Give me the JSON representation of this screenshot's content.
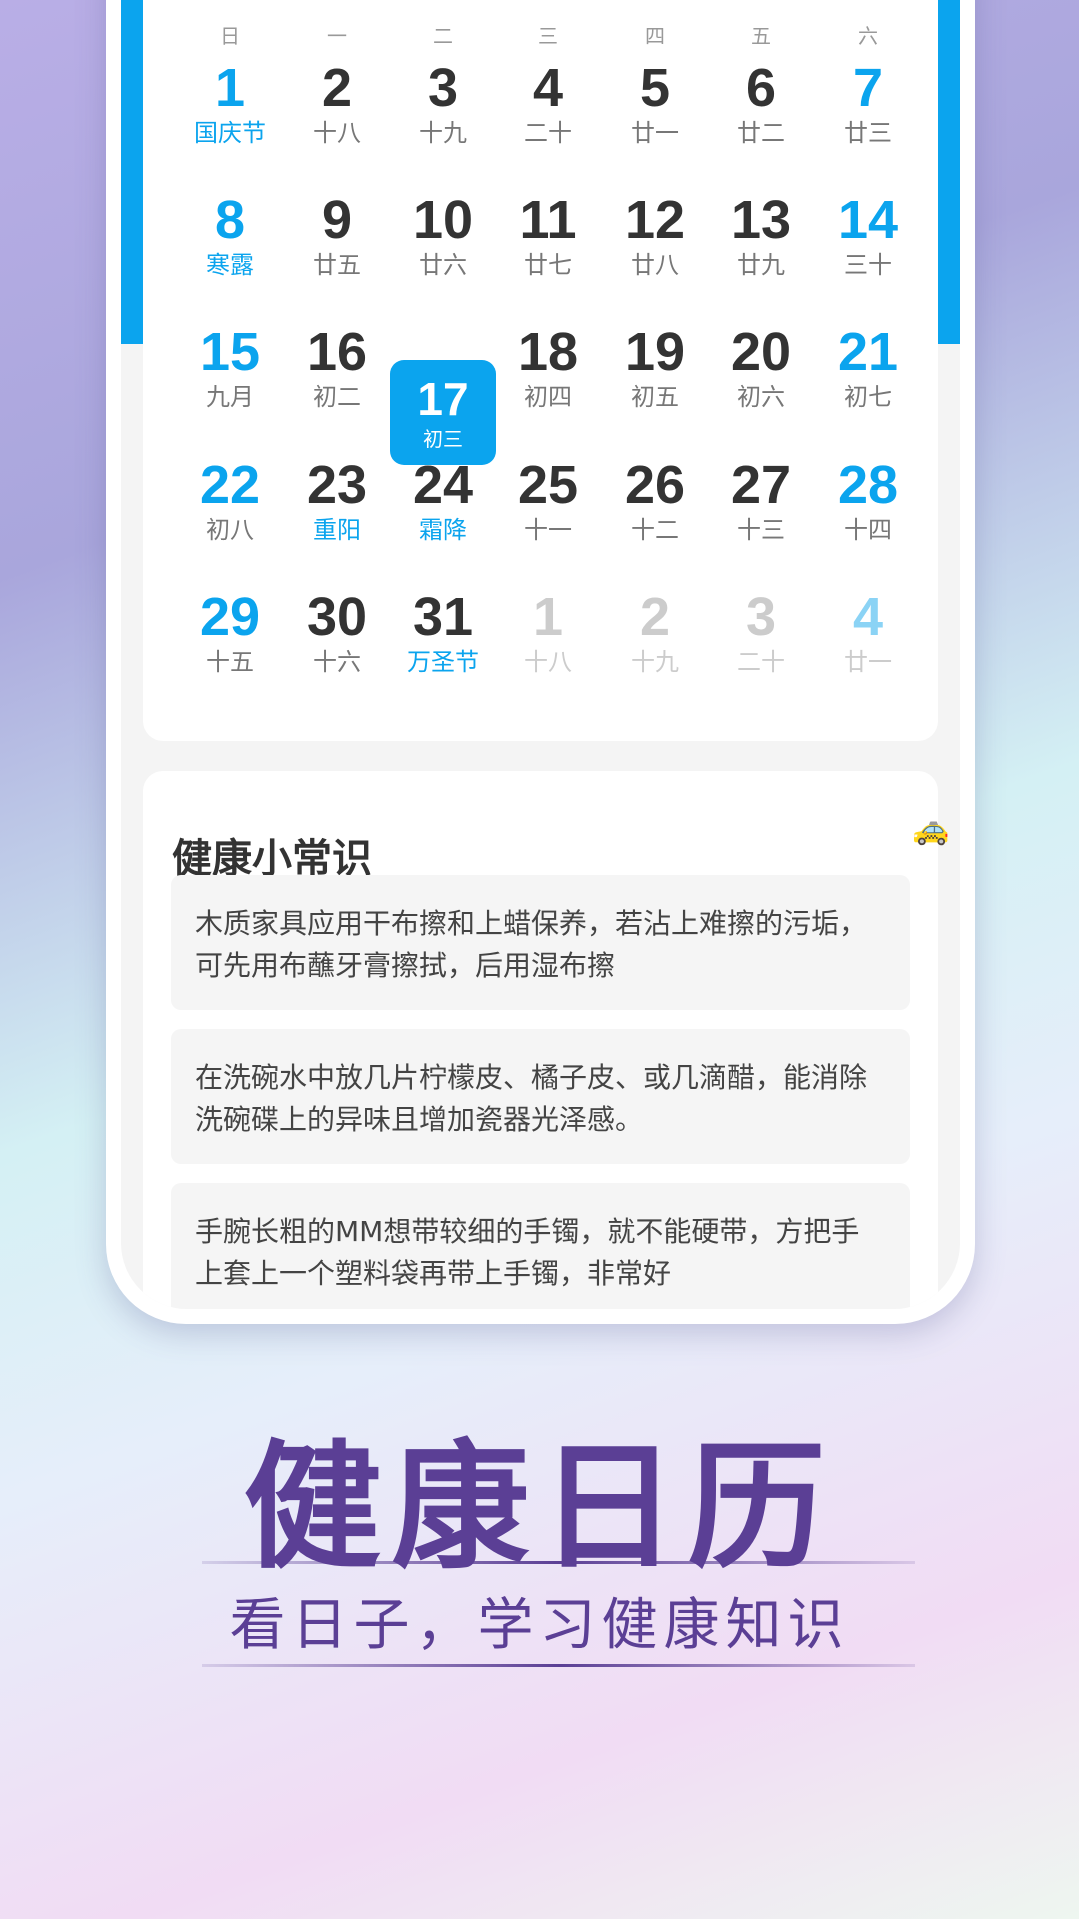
{
  "calendar": {
    "weekdays": [
      "日",
      "一",
      "二",
      "三",
      "四",
      "五",
      "六"
    ],
    "selected_day": 17,
    "accent_color": "#0ba4ee",
    "weeks": [
      [
        {
          "d": "1",
          "l": "国庆节",
          "f": 1
        },
        {
          "d": "2",
          "l": "十八"
        },
        {
          "d": "3",
          "l": "十九"
        },
        {
          "d": "4",
          "l": "二十"
        },
        {
          "d": "5",
          "l": "廿一"
        },
        {
          "d": "6",
          "l": "廿二"
        },
        {
          "d": "7",
          "l": "廿三"
        }
      ],
      [
        {
          "d": "8",
          "l": "寒露",
          "f": 1
        },
        {
          "d": "9",
          "l": "廿五"
        },
        {
          "d": "10",
          "l": "廿六"
        },
        {
          "d": "11",
          "l": "廿七"
        },
        {
          "d": "12",
          "l": "廿八"
        },
        {
          "d": "13",
          "l": "廿九"
        },
        {
          "d": "14",
          "l": "三十"
        }
      ],
      [
        {
          "d": "15",
          "l": "九月"
        },
        {
          "d": "16",
          "l": "初二"
        },
        {
          "d": "17",
          "l": "初三",
          "s": 1
        },
        {
          "d": "18",
          "l": "初四"
        },
        {
          "d": "19",
          "l": "初五"
        },
        {
          "d": "20",
          "l": "初六"
        },
        {
          "d": "21",
          "l": "初七"
        }
      ],
      [
        {
          "d": "22",
          "l": "初八"
        },
        {
          "d": "23",
          "l": "重阳",
          "f": 1
        },
        {
          "d": "24",
          "l": "霜降",
          "f": 1
        },
        {
          "d": "25",
          "l": "十一"
        },
        {
          "d": "26",
          "l": "十二"
        },
        {
          "d": "27",
          "l": "十三"
        },
        {
          "d": "28",
          "l": "十四"
        }
      ],
      [
        {
          "d": "29",
          "l": "十五"
        },
        {
          "d": "30",
          "l": "十六"
        },
        {
          "d": "31",
          "l": "万圣节",
          "f": 1
        },
        {
          "d": "1",
          "l": "十八",
          "o": 1
        },
        {
          "d": "2",
          "l": "十九",
          "o": 1
        },
        {
          "d": "3",
          "l": "二十",
          "o": 1
        },
        {
          "d": "4",
          "l": "廿一",
          "o": 1
        }
      ]
    ]
  },
  "health": {
    "title": "健康小常识",
    "tips": [
      "木质家具应用干布擦和上蜡保养，若沾上难擦的污垢，可先用布蘸牙膏擦拭，后用湿布擦",
      "在洗碗水中放几片柠檬皮、橘子皮、或几滴醋，能消除洗碗碟上的异味且增加瓷器光泽感。",
      "手腕长粗的MM想带较细的手镯，就不能硬带，方把手上套上一个塑料袋再带上手镯，非常好"
    ]
  },
  "promo": {
    "title": "健康日历",
    "subtitle": "看日子，学习健康知识",
    "color": "#5b3f95"
  },
  "icons": {
    "floating": "taxi-icon"
  }
}
